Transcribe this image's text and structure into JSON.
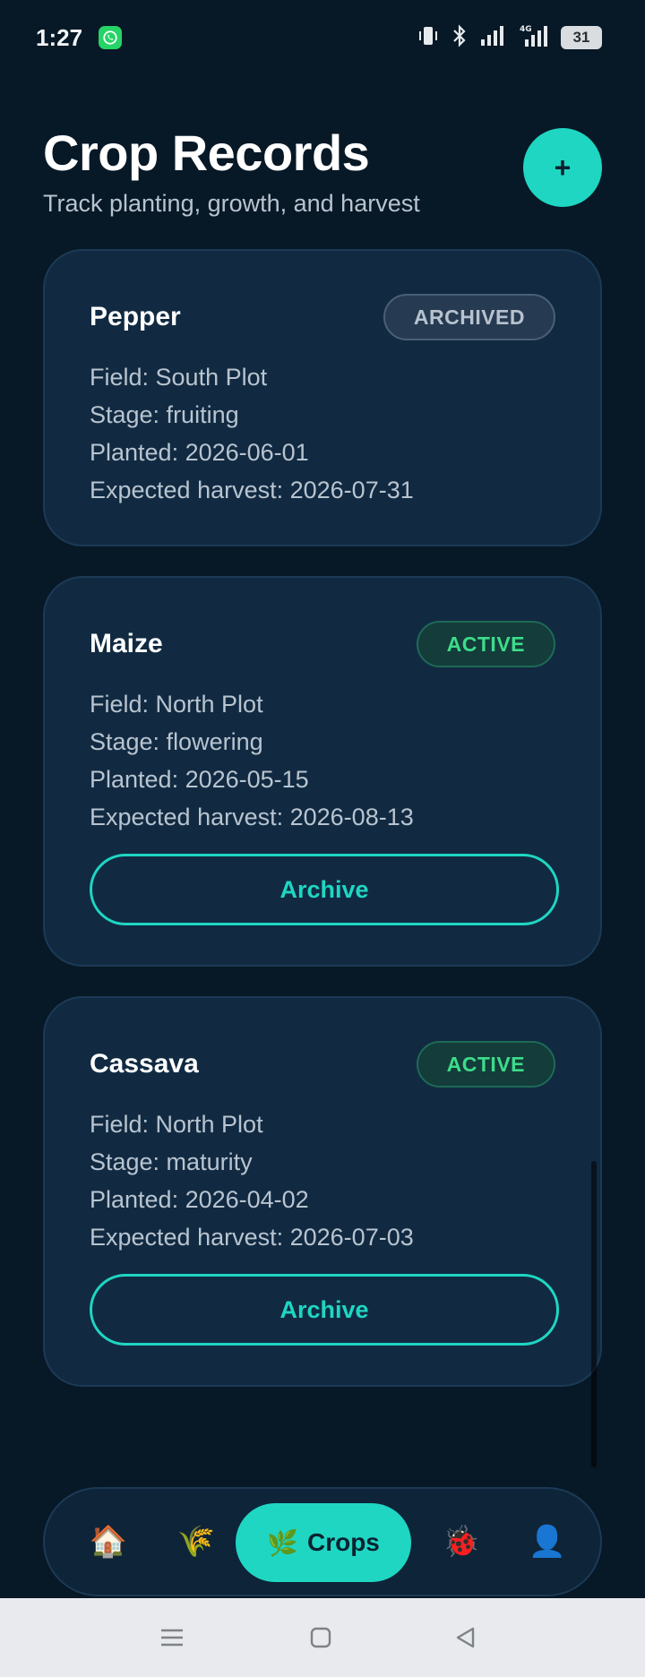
{
  "status_bar": {
    "time": "1:27",
    "battery": "31",
    "network": "4G"
  },
  "header": {
    "title": "Crop Records",
    "subtitle": "Track planting, growth, and harvest",
    "add_label": "+"
  },
  "crops": [
    {
      "name": "Pepper",
      "status": "ARCHIVED",
      "field": "Field: South Plot",
      "stage": "Stage: fruiting",
      "planted": "Planted: 2026-06-01",
      "harvest": "Expected harvest: 2026-07-31",
      "action": ""
    },
    {
      "name": "Maize",
      "status": "ACTIVE",
      "field": "Field: North Plot",
      "stage": "Stage: flowering",
      "planted": "Planted: 2026-05-15",
      "harvest": "Expected harvest: 2026-08-13",
      "action": "Archive"
    },
    {
      "name": "Cassava",
      "status": "ACTIVE",
      "field": "Field: North Plot",
      "stage": "Stage: maturity",
      "planted": "Planted: 2026-04-02",
      "harvest": "Expected harvest: 2026-07-03",
      "action": "Archive"
    }
  ],
  "nav": {
    "home_icon": "🏠",
    "harvest_icon": "🌾",
    "crops_icon": "🌿",
    "crops_label": "Crops",
    "pests_icon": "🐞",
    "profile_icon": "👤"
  },
  "colors": {
    "background": "#071826",
    "card": "#112a42",
    "accent": "#1fd6c2",
    "active_badge": "#3ddc8a",
    "archived_badge": "#b6c2ce"
  }
}
